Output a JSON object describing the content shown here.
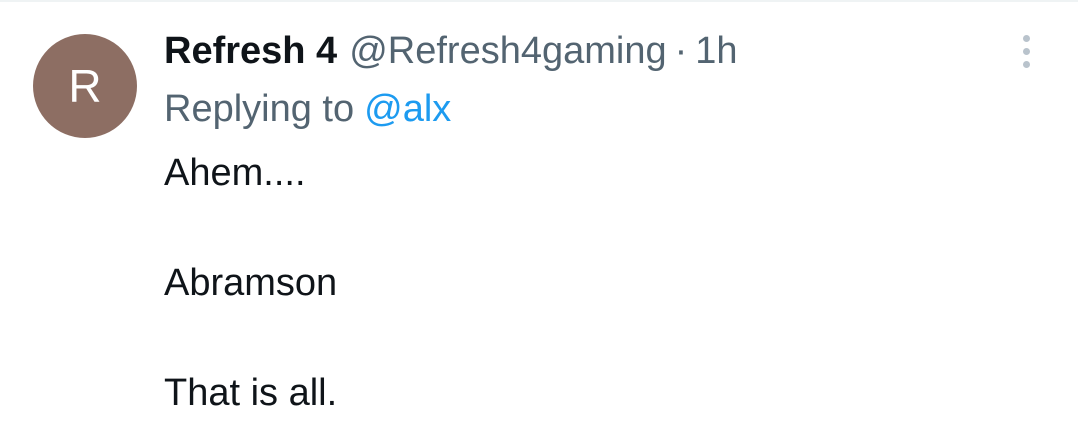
{
  "tweet": {
    "avatar_letter": "R",
    "avatar_color": "#8d6e63",
    "display_name": "Refresh 4",
    "handle": "@Refresh4gaming",
    "separator": "·",
    "time_ago": "1h",
    "replying_label": "Replying to",
    "replying_to": "@alx",
    "body_lines": [
      "Ahem....",
      "Abramson",
      "That is all."
    ],
    "more_icon": "more-vertical-icon"
  },
  "colors": {
    "text_primary": "#0f1419",
    "text_secondary": "#536471",
    "link": "#1d9bf0"
  }
}
